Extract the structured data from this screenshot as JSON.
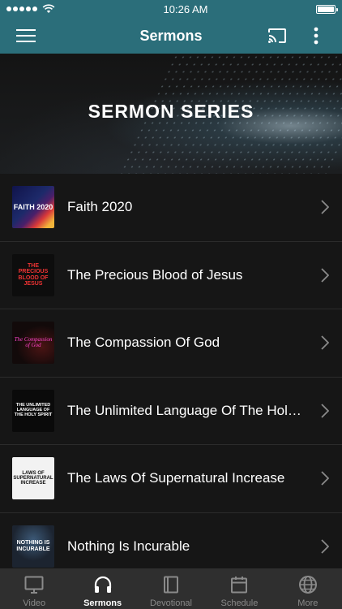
{
  "status_bar": {
    "time": "10:26 AM"
  },
  "header": {
    "title": "Sermons",
    "menu_icon": "hamburger-menu-icon",
    "cast_icon": "cast-icon",
    "more_icon": "more-vertical-icon"
  },
  "banner": {
    "title": "SERMON SERIES"
  },
  "series": [
    {
      "title": "Faith 2020",
      "thumb_text": "FAITH 2020"
    },
    {
      "title": "The Precious Blood of Jesus",
      "thumb_text": "THE PRECIOUS BLOOD OF JESUS"
    },
    {
      "title": "The Compassion Of God",
      "thumb_text": "The Compassion of God"
    },
    {
      "title": "The Unlimited Language Of The Holy Spirit",
      "thumb_text": "THE UNLIMITED LANGUAGE OF THE HOLY SPIRIT"
    },
    {
      "title": "The Laws Of Supernatural Increase",
      "thumb_text": "LAWS OF SUPERNATURAL INCREASE"
    },
    {
      "title": "Nothing Is Incurable",
      "thumb_text": "NOTHING IS INCURABLE"
    }
  ],
  "tabs": [
    {
      "label": "Video",
      "icon": "monitor-icon",
      "active": false
    },
    {
      "label": "Sermons",
      "icon": "headphones-icon",
      "active": true
    },
    {
      "label": "Devotional",
      "icon": "book-icon",
      "active": false
    },
    {
      "label": "Schedule",
      "icon": "calendar-icon",
      "active": false
    },
    {
      "label": "More",
      "icon": "globe-icon",
      "active": false
    }
  ],
  "colors": {
    "header_bg": "#2b6e7a",
    "list_bg": "#161616",
    "tab_bar_bg": "#2f2f2f",
    "active_tab": "#ffffff",
    "inactive_tab": "#8a8a8a"
  }
}
